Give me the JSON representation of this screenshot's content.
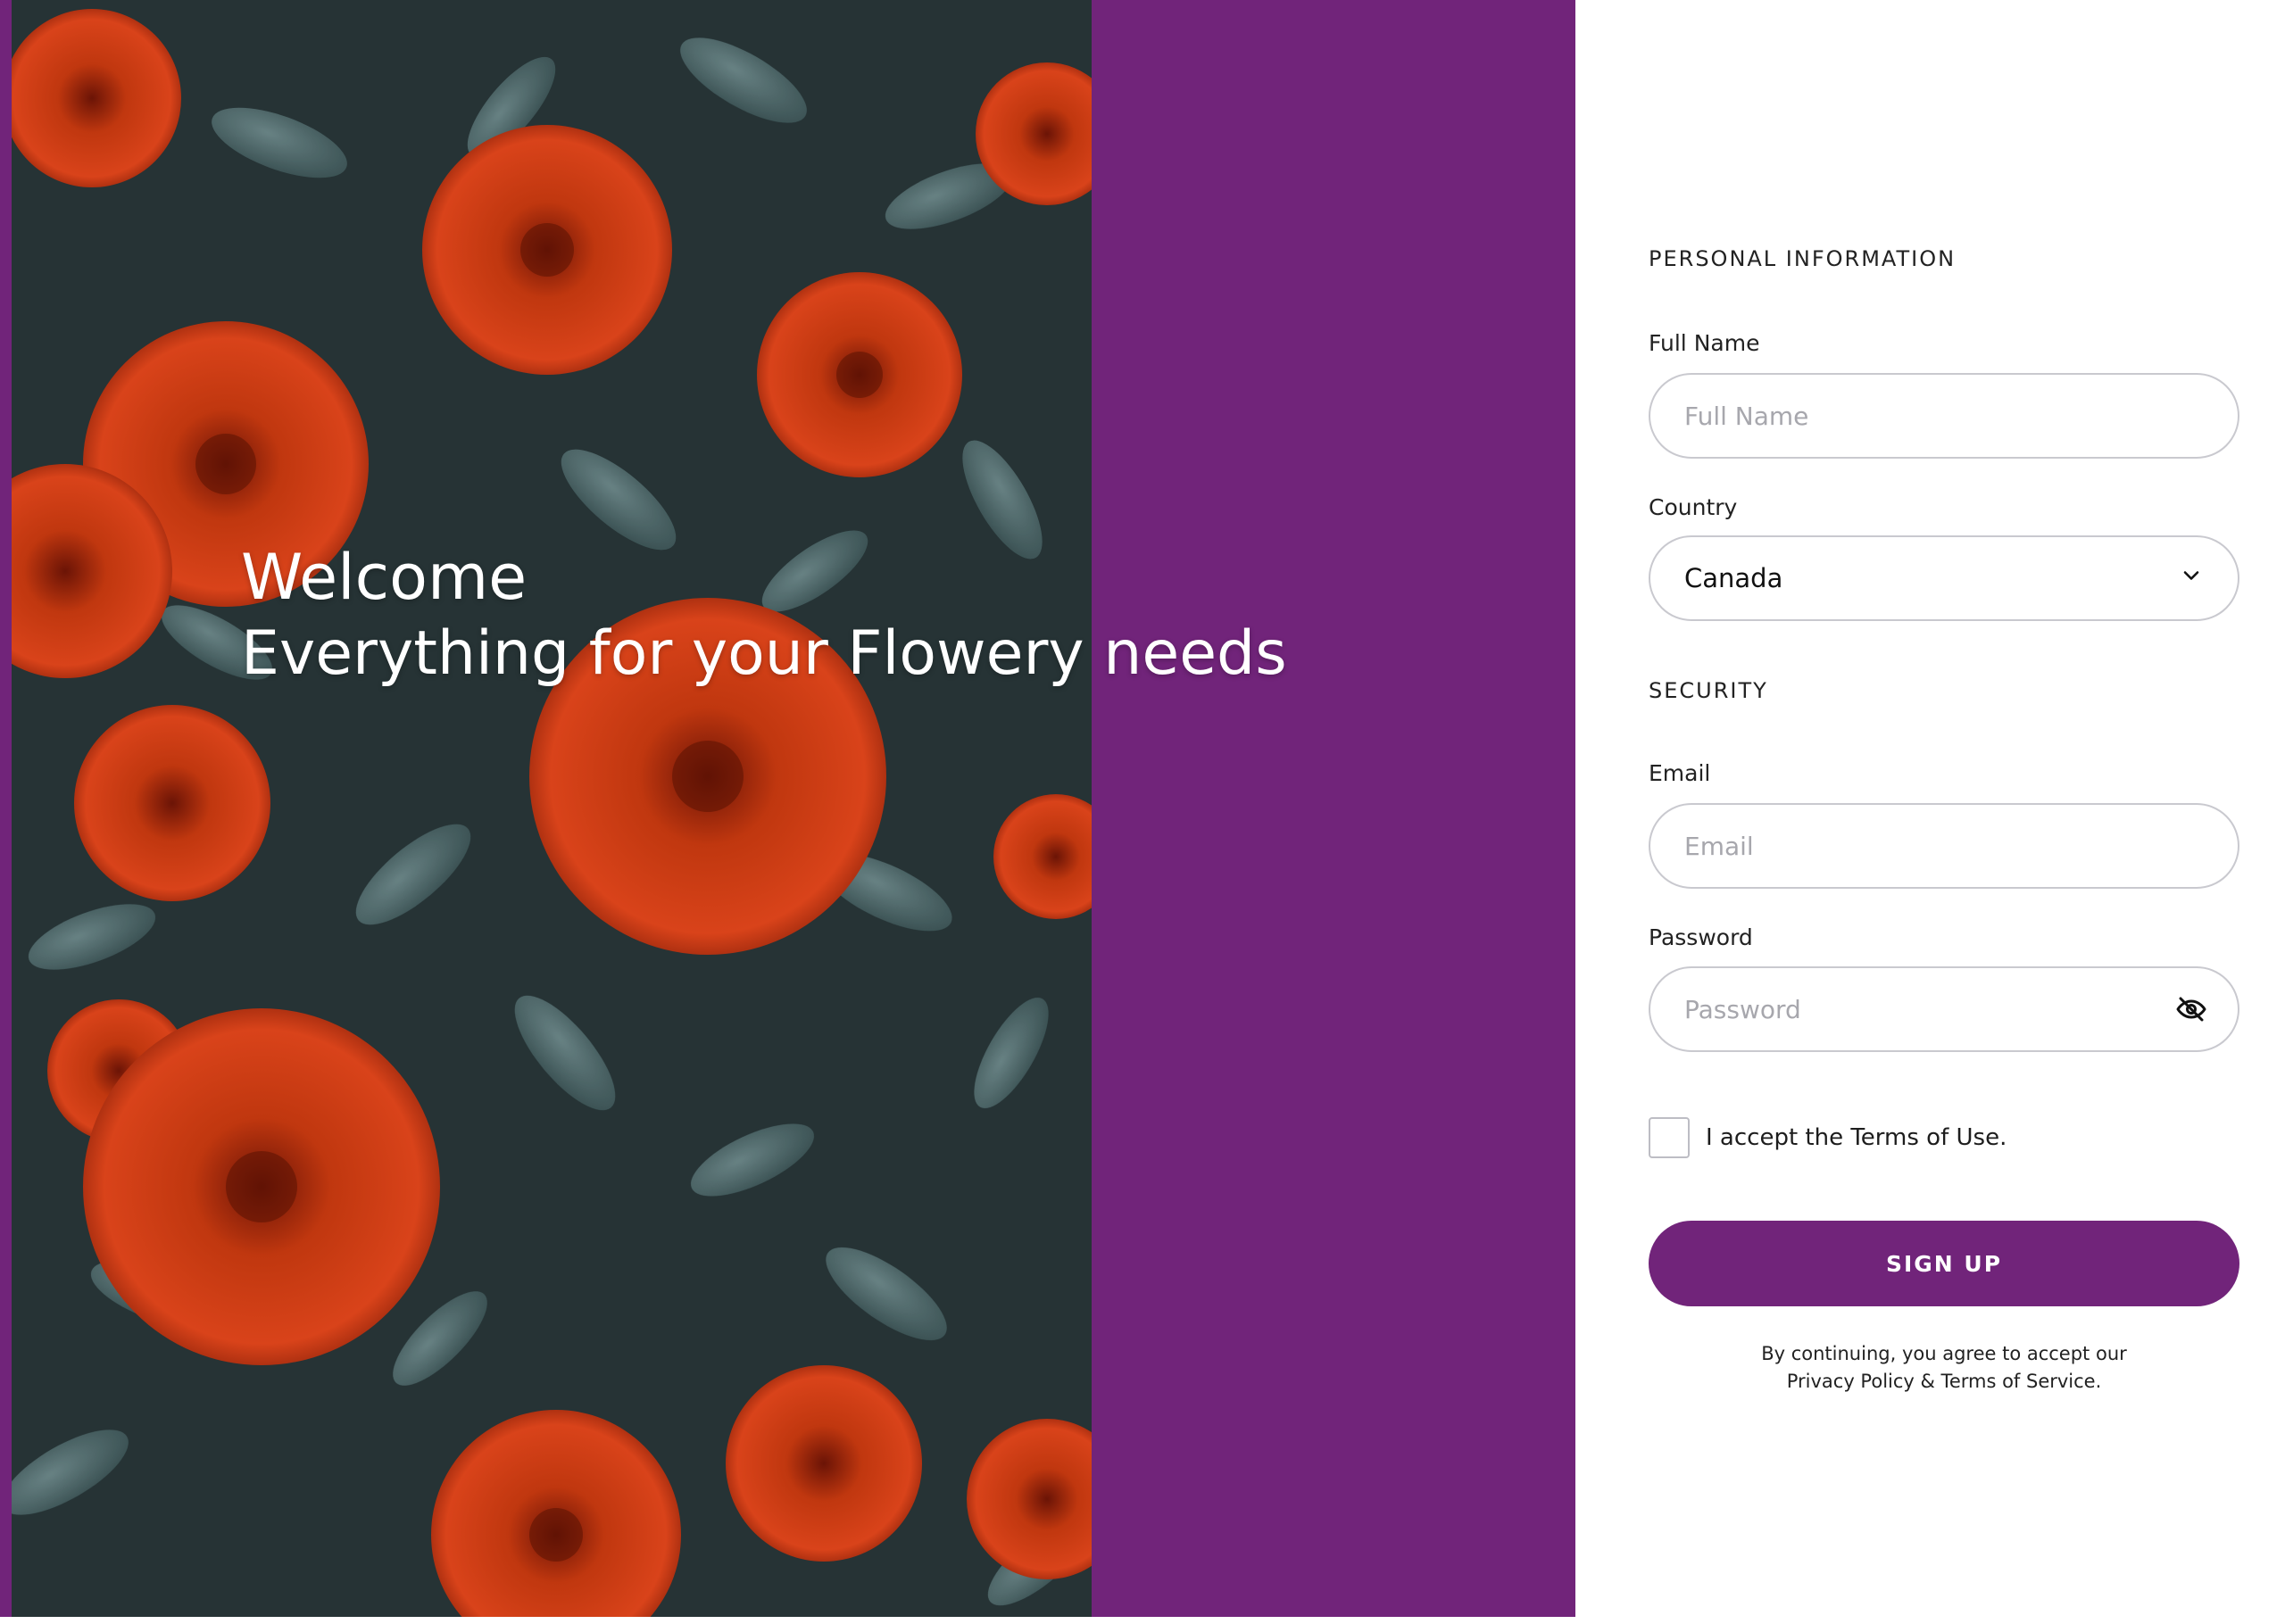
{
  "hero": {
    "welcome": "Welcome",
    "tagline": "Everything for your Flowery needs"
  },
  "personal": {
    "section_title": "PERSONAL INFORMATION",
    "full_name_label": "Full Name",
    "full_name_placeholder": "Full Name",
    "country_label": "Country",
    "country_value": "Canada"
  },
  "security": {
    "section_title": "SECURITY",
    "email_label": "Email",
    "email_placeholder": "Email",
    "password_label": "Password",
    "password_placeholder": "Password"
  },
  "terms": {
    "checkbox_label": "I accept the Terms of Use.",
    "checked": false
  },
  "actions": {
    "signup_label": "SIGN UP"
  },
  "legal": {
    "line1": "By continuing, you agree to accept our",
    "line2": "Privacy Policy & Terms of Service."
  },
  "icons": {
    "country_dropdown": "chevron-down-icon",
    "password_toggle": "eye-off-icon"
  },
  "colors": {
    "accent": "#71247a",
    "input_border": "#c9c9cf",
    "placeholder": "#a7a7ad",
    "photo_petals": "#c0370f",
    "photo_leaves": "#4b6467"
  }
}
